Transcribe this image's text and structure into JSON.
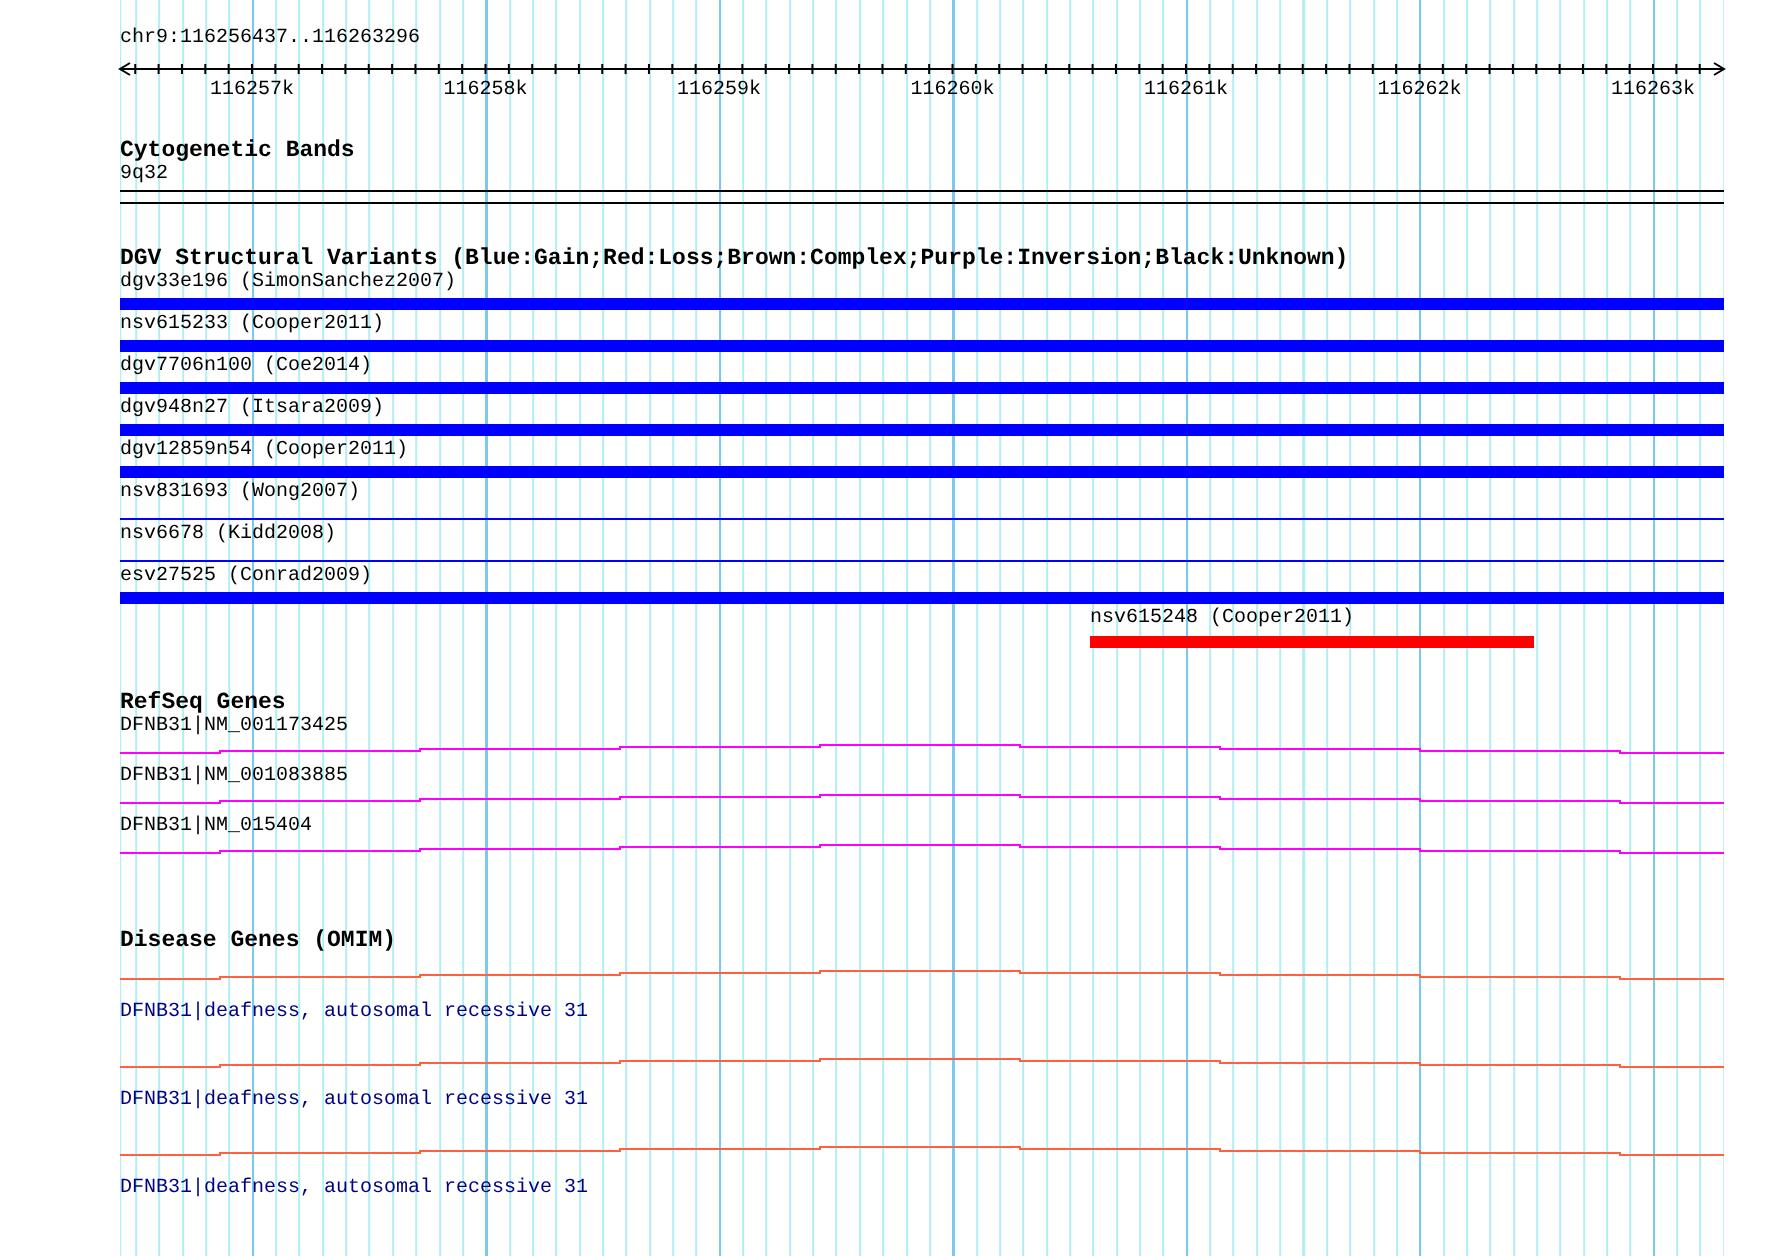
{
  "ruler": {
    "location": "chr9:116256437..116263296",
    "ticks": [
      "116257k",
      "116258k",
      "116259k",
      "116260k",
      "116261k",
      "116262k",
      "116263k"
    ]
  },
  "tracks": [
    {
      "kind": "cytoband",
      "title": "Cytogenetic Bands",
      "features": [
        {
          "label": "9q32"
        }
      ]
    },
    {
      "kind": "variants",
      "title": "DGV Structural Variants (Blue:Gain;Red:Loss;Brown:Complex;Purple:Inversion;Black:Unknown)",
      "features": [
        {
          "label": "dgv33e196 (SimonSanchez2007)",
          "color": "#0000ff",
          "kind": "full"
        },
        {
          "label": "nsv615233 (Cooper2011)",
          "color": "#0000ff",
          "kind": "full"
        },
        {
          "label": "dgv7706n100 (Coe2014)",
          "color": "#0000ff",
          "kind": "full"
        },
        {
          "label": "dgv948n27 (Itsara2009)",
          "color": "#0000ff",
          "kind": "full"
        },
        {
          "label": "dgv12859n54 (Cooper2011)",
          "color": "#0000ff",
          "kind": "full"
        },
        {
          "label": "nsv831693 (Wong2007)",
          "color": "#0000ff",
          "kind": "thin"
        },
        {
          "label": "nsv6678 (Kidd2008)",
          "color": "#0000ff",
          "kind": "thin"
        },
        {
          "label": "esv27525 (Conrad2009)",
          "color": "#0000ff",
          "kind": "full"
        },
        {
          "label": "nsv615248 (Cooper2011)",
          "color": "#ff0000",
          "kind": "partial"
        }
      ]
    },
    {
      "kind": "genes",
      "title": "RefSeq Genes",
      "features": [
        {
          "label": "DFNB31|NM_001173425"
        },
        {
          "label": "DFNB31|NM_001083885"
        },
        {
          "label": "DFNB31|NM_015404"
        }
      ]
    },
    {
      "kind": "disease",
      "title": "Disease Genes (OMIM)",
      "features": [
        {
          "label": "DFNB31|deafness, autosomal recessive 31"
        },
        {
          "label": "DFNB31|deafness, autosomal recessive 31"
        },
        {
          "label": "DFNB31|deafness, autosomal recessive 31"
        }
      ]
    }
  ]
}
